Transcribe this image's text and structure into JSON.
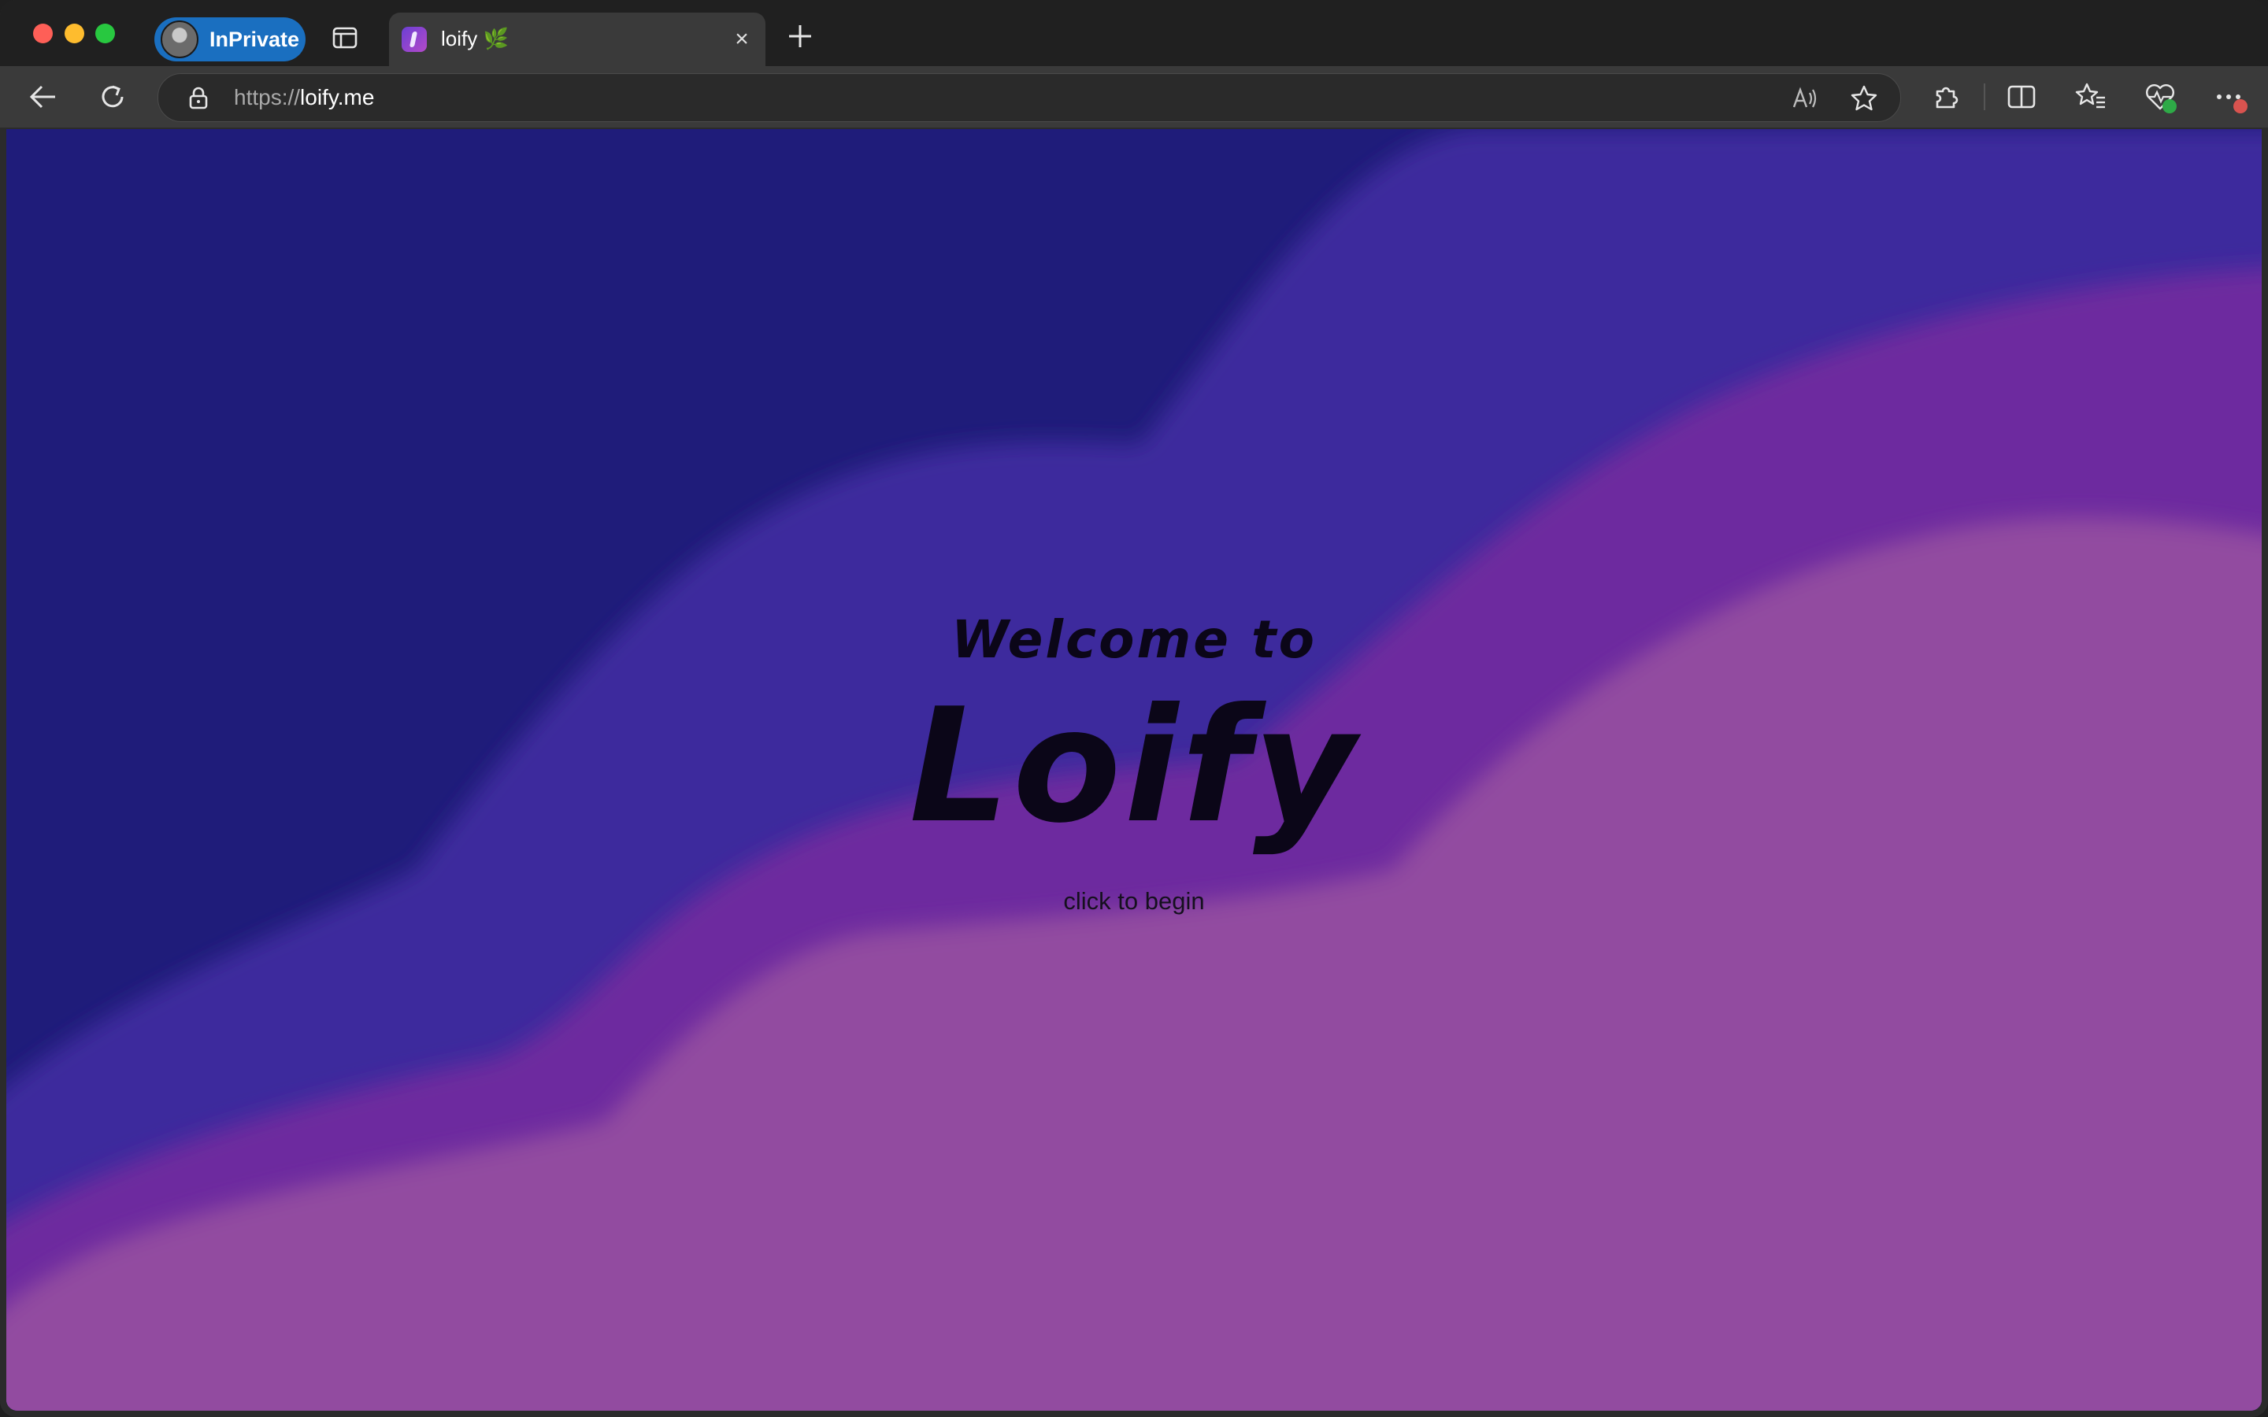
{
  "browser": {
    "profile_label": "InPrivate",
    "tab": {
      "title": "loify 🌿",
      "close_label": "×"
    },
    "address": {
      "scheme": "https://",
      "host": "loify.me"
    }
  },
  "page": {
    "welcome": "Welcome to",
    "brand": "Loify",
    "cta": "click to begin"
  },
  "colors": {
    "layer_dark": "#1f1c7a",
    "layer_indigo": "#3e2b9d",
    "layer_violet": "#6d2a9f",
    "layer_magenta": "#924ba0",
    "inprivate_blue": "#1a6fc0"
  },
  "icons": [
    "back-icon",
    "refresh-icon",
    "lock-icon",
    "read-aloud-icon",
    "favorite-star-icon",
    "extensions-icon",
    "split-screen-icon",
    "favorites-icon",
    "browser-essentials-icon",
    "more-icon",
    "tab-actions-icon",
    "new-tab-icon",
    "close-icon"
  ]
}
